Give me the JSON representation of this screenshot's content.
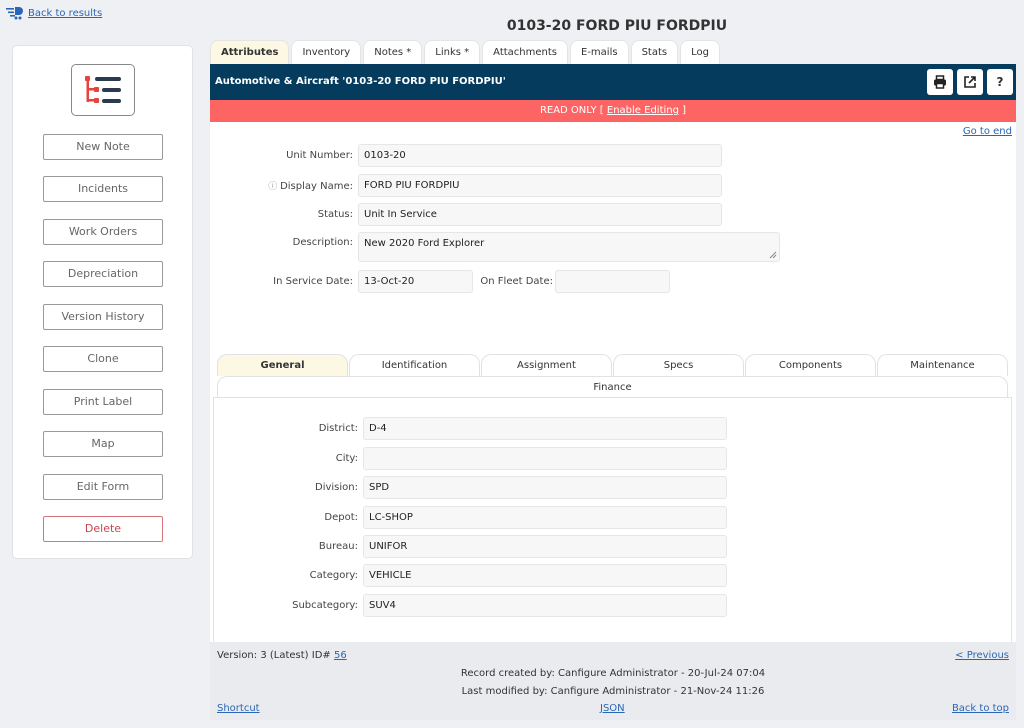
{
  "nav": {
    "back_label": "Back to results"
  },
  "page": {
    "title": "0103-20 FORD PIU FORDPIU"
  },
  "sidebar": {
    "buttons": [
      {
        "label": "New Note"
      },
      {
        "label": "Incidents"
      },
      {
        "label": "Work Orders"
      },
      {
        "label": "Depreciation"
      },
      {
        "label": "Version History"
      },
      {
        "label": "Clone"
      },
      {
        "label": "Print Label"
      },
      {
        "label": "Map"
      },
      {
        "label": "Edit Form"
      },
      {
        "label": "Delete"
      }
    ]
  },
  "tabs": [
    {
      "label": "Attributes",
      "active": true
    },
    {
      "label": "Inventory"
    },
    {
      "label": "Notes *"
    },
    {
      "label": "Links *"
    },
    {
      "label": "Attachments"
    },
    {
      "label": "E-mails"
    },
    {
      "label": "Stats"
    },
    {
      "label": "Log"
    }
  ],
  "header": {
    "title": "Automotive & Aircraft '0103-20 FORD PIU FORDPIU'",
    "help_label": "?"
  },
  "readonly": {
    "text": "READ ONLY [ ",
    "link": "Enable Editing",
    "close": " ]"
  },
  "content": {
    "goto_end": "Go to end",
    "fields": {
      "unit_number": {
        "label": "Unit Number:",
        "value": "0103-20"
      },
      "display_name": {
        "label": "Display Name:",
        "value": "FORD PIU FORDPIU"
      },
      "status": {
        "label": "Status:",
        "value": "Unit In Service"
      },
      "description": {
        "label": "Description:",
        "value": "New 2020 Ford Explorer"
      },
      "in_service_date": {
        "label": "In Service Date:",
        "value": "13-Oct-20"
      },
      "on_fleet_date": {
        "label": "On Fleet Date:",
        "value": ""
      }
    },
    "subtabs": [
      {
        "label": "General",
        "active": true
      },
      {
        "label": "Identification"
      },
      {
        "label": "Assignment"
      },
      {
        "label": "Specs"
      },
      {
        "label": "Components"
      },
      {
        "label": "Maintenance"
      },
      {
        "label": "Finance"
      }
    ],
    "general": [
      {
        "label": "District:",
        "value": "D-4"
      },
      {
        "label": "City:",
        "value": ""
      },
      {
        "label": "Division:",
        "value": "SPD"
      },
      {
        "label": "Depot:",
        "value": "LC-SHOP"
      },
      {
        "label": "Bureau:",
        "value": "UNIFOR"
      },
      {
        "label": "Category:",
        "value": "VEHICLE"
      },
      {
        "label": "Subcategory:",
        "value": "SUV4"
      }
    ]
  },
  "footer": {
    "version_text": "Version: 3 (Latest) ID# ",
    "id_link": "56",
    "previous": "< Previous",
    "created": "Record created by:  Canfigure Administrator - 20-Jul-24 07:04",
    "modified": "Last modified by:  Canfigure Administrator - 21-Nov-24 11:26",
    "shortcut": "Shortcut",
    "json": "JSON",
    "back_to_top": "Back to top"
  },
  "colors": {
    "header": "#053c5e",
    "readonly": "#fd6565",
    "active_tab": "#fcf8e3",
    "link": "#2a66b8",
    "logo_red": "#e8423c",
    "logo_dark": "#2b3a4e"
  }
}
